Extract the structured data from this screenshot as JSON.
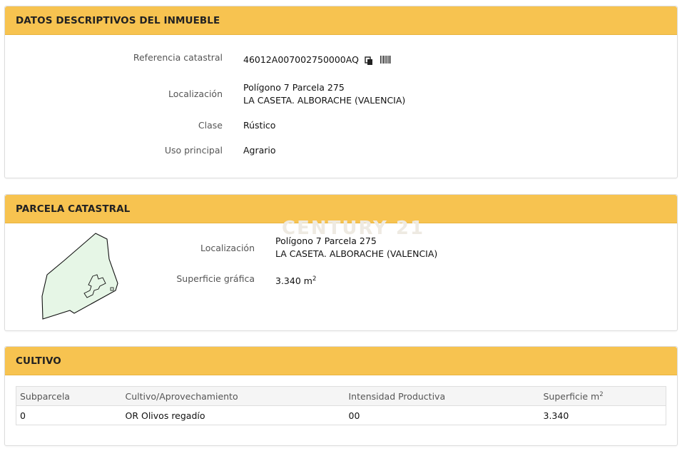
{
  "descriptivos": {
    "header": "DATOS DESCRIPTIVOS DEL INMUEBLE",
    "referencia_label": "Referencia catastral",
    "referencia_value": "46012A007002750000AQ",
    "localizacion_label": "Localización",
    "localizacion_line1": "Polígono 7 Parcela 275",
    "localizacion_line2": "LA CASETA. ALBORACHE (VALENCIA)",
    "clase_label": "Clase",
    "clase_value": "Rústico",
    "uso_label": "Uso principal",
    "uso_value": "Agrario"
  },
  "parcela": {
    "header": "PARCELA CATASTRAL",
    "watermark": "CENTURY 21",
    "localizacion_label": "Localización",
    "localizacion_line1": "Polígono 7 Parcela 275",
    "localizacion_line2": "LA CASETA. ALBORACHE (VALENCIA)",
    "superficie_label": "Superficie gráfica",
    "superficie_value": "3.340 m",
    "superficie_unit_sup": "2"
  },
  "cultivo": {
    "header": "CULTIVO",
    "columns": [
      "Subparcela",
      "Cultivo/Aprovechamiento",
      "Intensidad Productiva",
      "Superficie m"
    ],
    "superficie_sup": "2",
    "rows": [
      [
        "0",
        "OR Olivos regadío",
        "00",
        "3.340"
      ]
    ]
  },
  "icons": {
    "copy": "copy-icon",
    "barcode": "barcode-icon"
  }
}
